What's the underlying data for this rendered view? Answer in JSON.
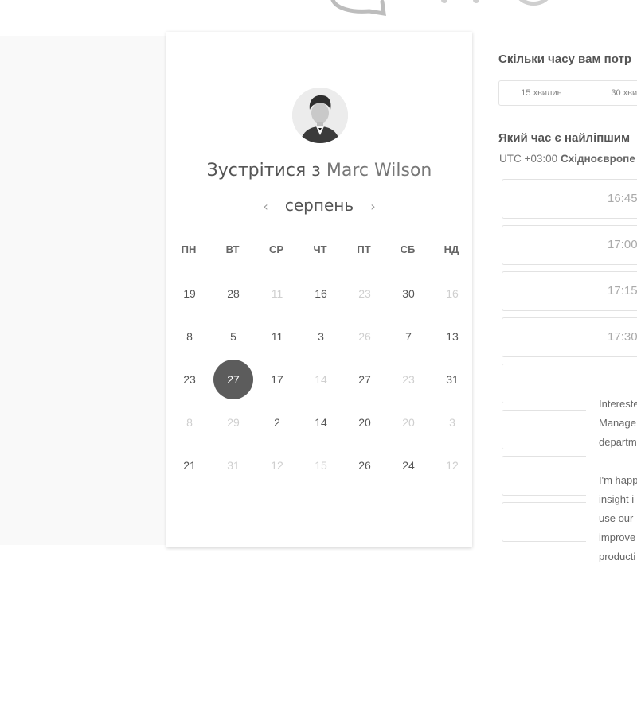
{
  "card": {
    "title_prefix": "Зустрітися з",
    "person_name": "Marc Wilson",
    "month": "серпень",
    "prev_arrow": "‹",
    "next_arrow": "›"
  },
  "calendar": {
    "weekdays": [
      "ПН",
      "ВТ",
      "СР",
      "ЧТ",
      "ПТ",
      "СБ",
      "НД"
    ],
    "weeks": [
      [
        {
          "d": "19",
          "m": false
        },
        {
          "d": "28",
          "m": false
        },
        {
          "d": "11",
          "m": true
        },
        {
          "d": "16",
          "m": false
        },
        {
          "d": "23",
          "m": true
        },
        {
          "d": "30",
          "m": false
        },
        {
          "d": "16",
          "m": true
        }
      ],
      [
        {
          "d": "8",
          "m": false
        },
        {
          "d": "5",
          "m": false
        },
        {
          "d": "11",
          "m": false
        },
        {
          "d": "3",
          "m": false
        },
        {
          "d": "26",
          "m": true
        },
        {
          "d": "7",
          "m": false
        },
        {
          "d": "13",
          "m": false
        }
      ],
      [
        {
          "d": "23",
          "m": false
        },
        {
          "d": "27",
          "m": false,
          "selected": true
        },
        {
          "d": "17",
          "m": false
        },
        {
          "d": "14",
          "m": true
        },
        {
          "d": "27",
          "m": false
        },
        {
          "d": "23",
          "m": true
        },
        {
          "d": "31",
          "m": false
        }
      ],
      [
        {
          "d": "8",
          "m": true
        },
        {
          "d": "29",
          "m": true
        },
        {
          "d": "2",
          "m": false
        },
        {
          "d": "14",
          "m": false
        },
        {
          "d": "20",
          "m": false
        },
        {
          "d": "20",
          "m": true
        },
        {
          "d": "3",
          "m": true
        }
      ],
      [
        {
          "d": "21",
          "m": false
        },
        {
          "d": "31",
          "m": true
        },
        {
          "d": "12",
          "m": true
        },
        {
          "d": "15",
          "m": true
        },
        {
          "d": "26",
          "m": false
        },
        {
          "d": "24",
          "m": false
        },
        {
          "d": "12",
          "m": true
        }
      ]
    ]
  },
  "right": {
    "duration_question": "Скільки часу вам потр",
    "durations": [
      "15 хвилин",
      "30 хвил"
    ],
    "time_question": "Який час є найліпшим",
    "tz_offset": "UTC +03:00",
    "tz_name": "Східноєвропе",
    "slots": [
      "16:45",
      "17:00",
      "17:15",
      "17:30",
      "",
      "",
      "",
      ""
    ]
  },
  "bio": {
    "lines": [
      "Intereste",
      "Manage",
      "departm",
      "",
      "I'm happ",
      "insight i",
      "use our",
      "improve",
      "producti"
    ]
  },
  "colors": {
    "selected_day_bg": "#5c5c5c",
    "muted_day": "#cfcfcf",
    "panel_bg": "#f9f9f9"
  },
  "icons": {
    "avatar": "person-avatar",
    "prev": "chevron-left-icon",
    "next": "chevron-right-icon",
    "logo": "brand-logo"
  }
}
